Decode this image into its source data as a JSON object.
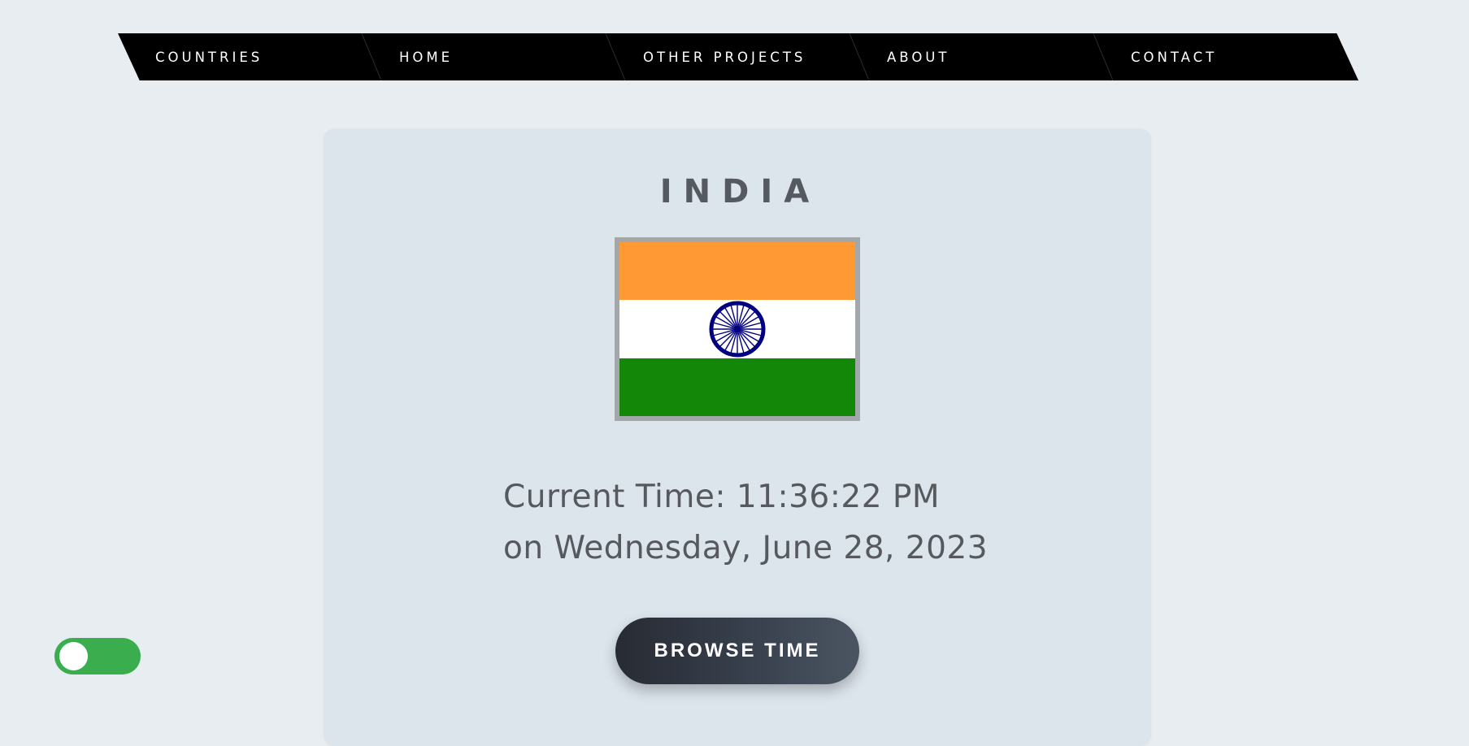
{
  "nav": {
    "items": [
      {
        "label": "COUNTRIES"
      },
      {
        "label": "HOME"
      },
      {
        "label": "OTHER PROJECTS"
      },
      {
        "label": "ABOUT"
      },
      {
        "label": "CONTACT"
      }
    ]
  },
  "country": {
    "name": "INDIA",
    "flag_icon": "india-flag",
    "flag_colors": {
      "top": "#ff9933",
      "middle": "#ffffff",
      "bottom": "#138808",
      "chakra": "#000080"
    }
  },
  "time": {
    "line1": "Current Time: 11:36:22 PM",
    "line2": "on Wednesday, June 28, 2023"
  },
  "actions": {
    "browse_label": "BROWSE TIME"
  },
  "theme_toggle": {
    "state": "on",
    "color": "#3aad4e"
  }
}
